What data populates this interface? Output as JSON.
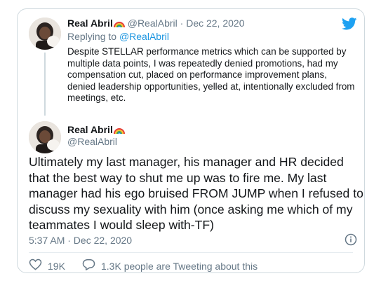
{
  "reply_tweet": {
    "author_name": "Real Abril",
    "handle": "@RealAbril",
    "separator": "·",
    "date": "Dec 22, 2020",
    "replying_prefix": "Replying to",
    "replying_to": "@RealAbril",
    "text": "Despite STELLAR performance metrics which can be supported by multiple data points, I was repeatedly denied promotions, had my compensation cut, placed on performance improvement plans, denied leadership opportunities, yelled at, intentionally excluded from meetings, etc."
  },
  "main_tweet": {
    "author_name": "Real Abril",
    "handle": "@RealAbril",
    "text": "Ultimately my last manager, his manager and HR decided that the best way to shut me up was to fire me. My last manager had his ego bruised FROM JUMP when I refused to discuss my sexuality with him (once asking me which of my teammates I would sleep with-TF)",
    "timestamp": "5:37 AM · Dec 22, 2020"
  },
  "actions": {
    "likes": "19K",
    "conversation": "1.3K people are Tweeting about this"
  },
  "icons": {
    "brand": "twitter-bird-icon",
    "emoji": "rainbow-emoji-icon",
    "info": "info-icon",
    "like": "heart-icon",
    "conversation": "speech-bubble-icon"
  },
  "colors": {
    "twitter_blue": "#1da1f2",
    "link_blue": "#1b95e0",
    "muted": "#657786",
    "border": "#cfd9de"
  }
}
